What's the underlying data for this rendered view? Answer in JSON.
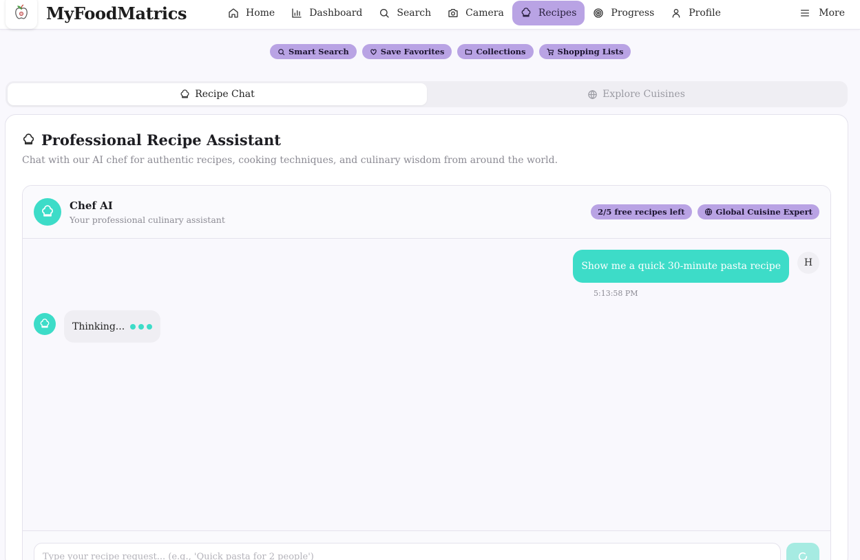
{
  "app": {
    "brand": "MyFoodMatrics"
  },
  "nav": {
    "items": [
      {
        "label": "Home",
        "icon": "home-icon"
      },
      {
        "label": "Dashboard",
        "icon": "bar-chart-icon"
      },
      {
        "label": "Search",
        "icon": "search-icon"
      },
      {
        "label": "Camera",
        "icon": "camera-icon"
      },
      {
        "label": "Recipes",
        "icon": "chef-hat-icon",
        "active": true
      },
      {
        "label": "Progress",
        "icon": "target-icon"
      },
      {
        "label": "Profile",
        "icon": "user-icon"
      }
    ],
    "more_label": "More"
  },
  "features": [
    {
      "label": "Smart Search",
      "icon": "search-icon"
    },
    {
      "label": "Save Favorites",
      "icon": "heart-icon"
    },
    {
      "label": "Collections",
      "icon": "folder-icon"
    },
    {
      "label": "Shopping Lists",
      "icon": "cart-icon"
    }
  ],
  "tabs": [
    {
      "label": "Recipe Chat",
      "icon": "chef-hat-icon",
      "active": true
    },
    {
      "label": "Explore Cuisines",
      "icon": "globe-icon",
      "active": false
    }
  ],
  "assistant": {
    "title": "Professional Recipe Assistant",
    "subtitle": "Chat with our AI chef for authentic recipes, cooking techniques, and culinary wisdom from around the world."
  },
  "chat": {
    "bot_name": "Chef AI",
    "bot_role": "Your professional culinary assistant",
    "badges": [
      {
        "label": "2/5 free recipes left"
      },
      {
        "label": "Global Cuisine Expert",
        "icon": "globe-icon"
      }
    ],
    "messages": [
      {
        "from": "user",
        "text": "Show me a quick 30-minute pasta recipe",
        "time": "5:13:58 PM",
        "avatar": "H"
      }
    ],
    "thinking_text": "Thinking...",
    "input_placeholder": "Type your recipe request... (e.g., 'Quick pasta for 2 people')",
    "input_value": ""
  },
  "colors": {
    "accent": "#b9a3e4",
    "teal": "#3ddcc8",
    "background": "#f9f8fd"
  }
}
